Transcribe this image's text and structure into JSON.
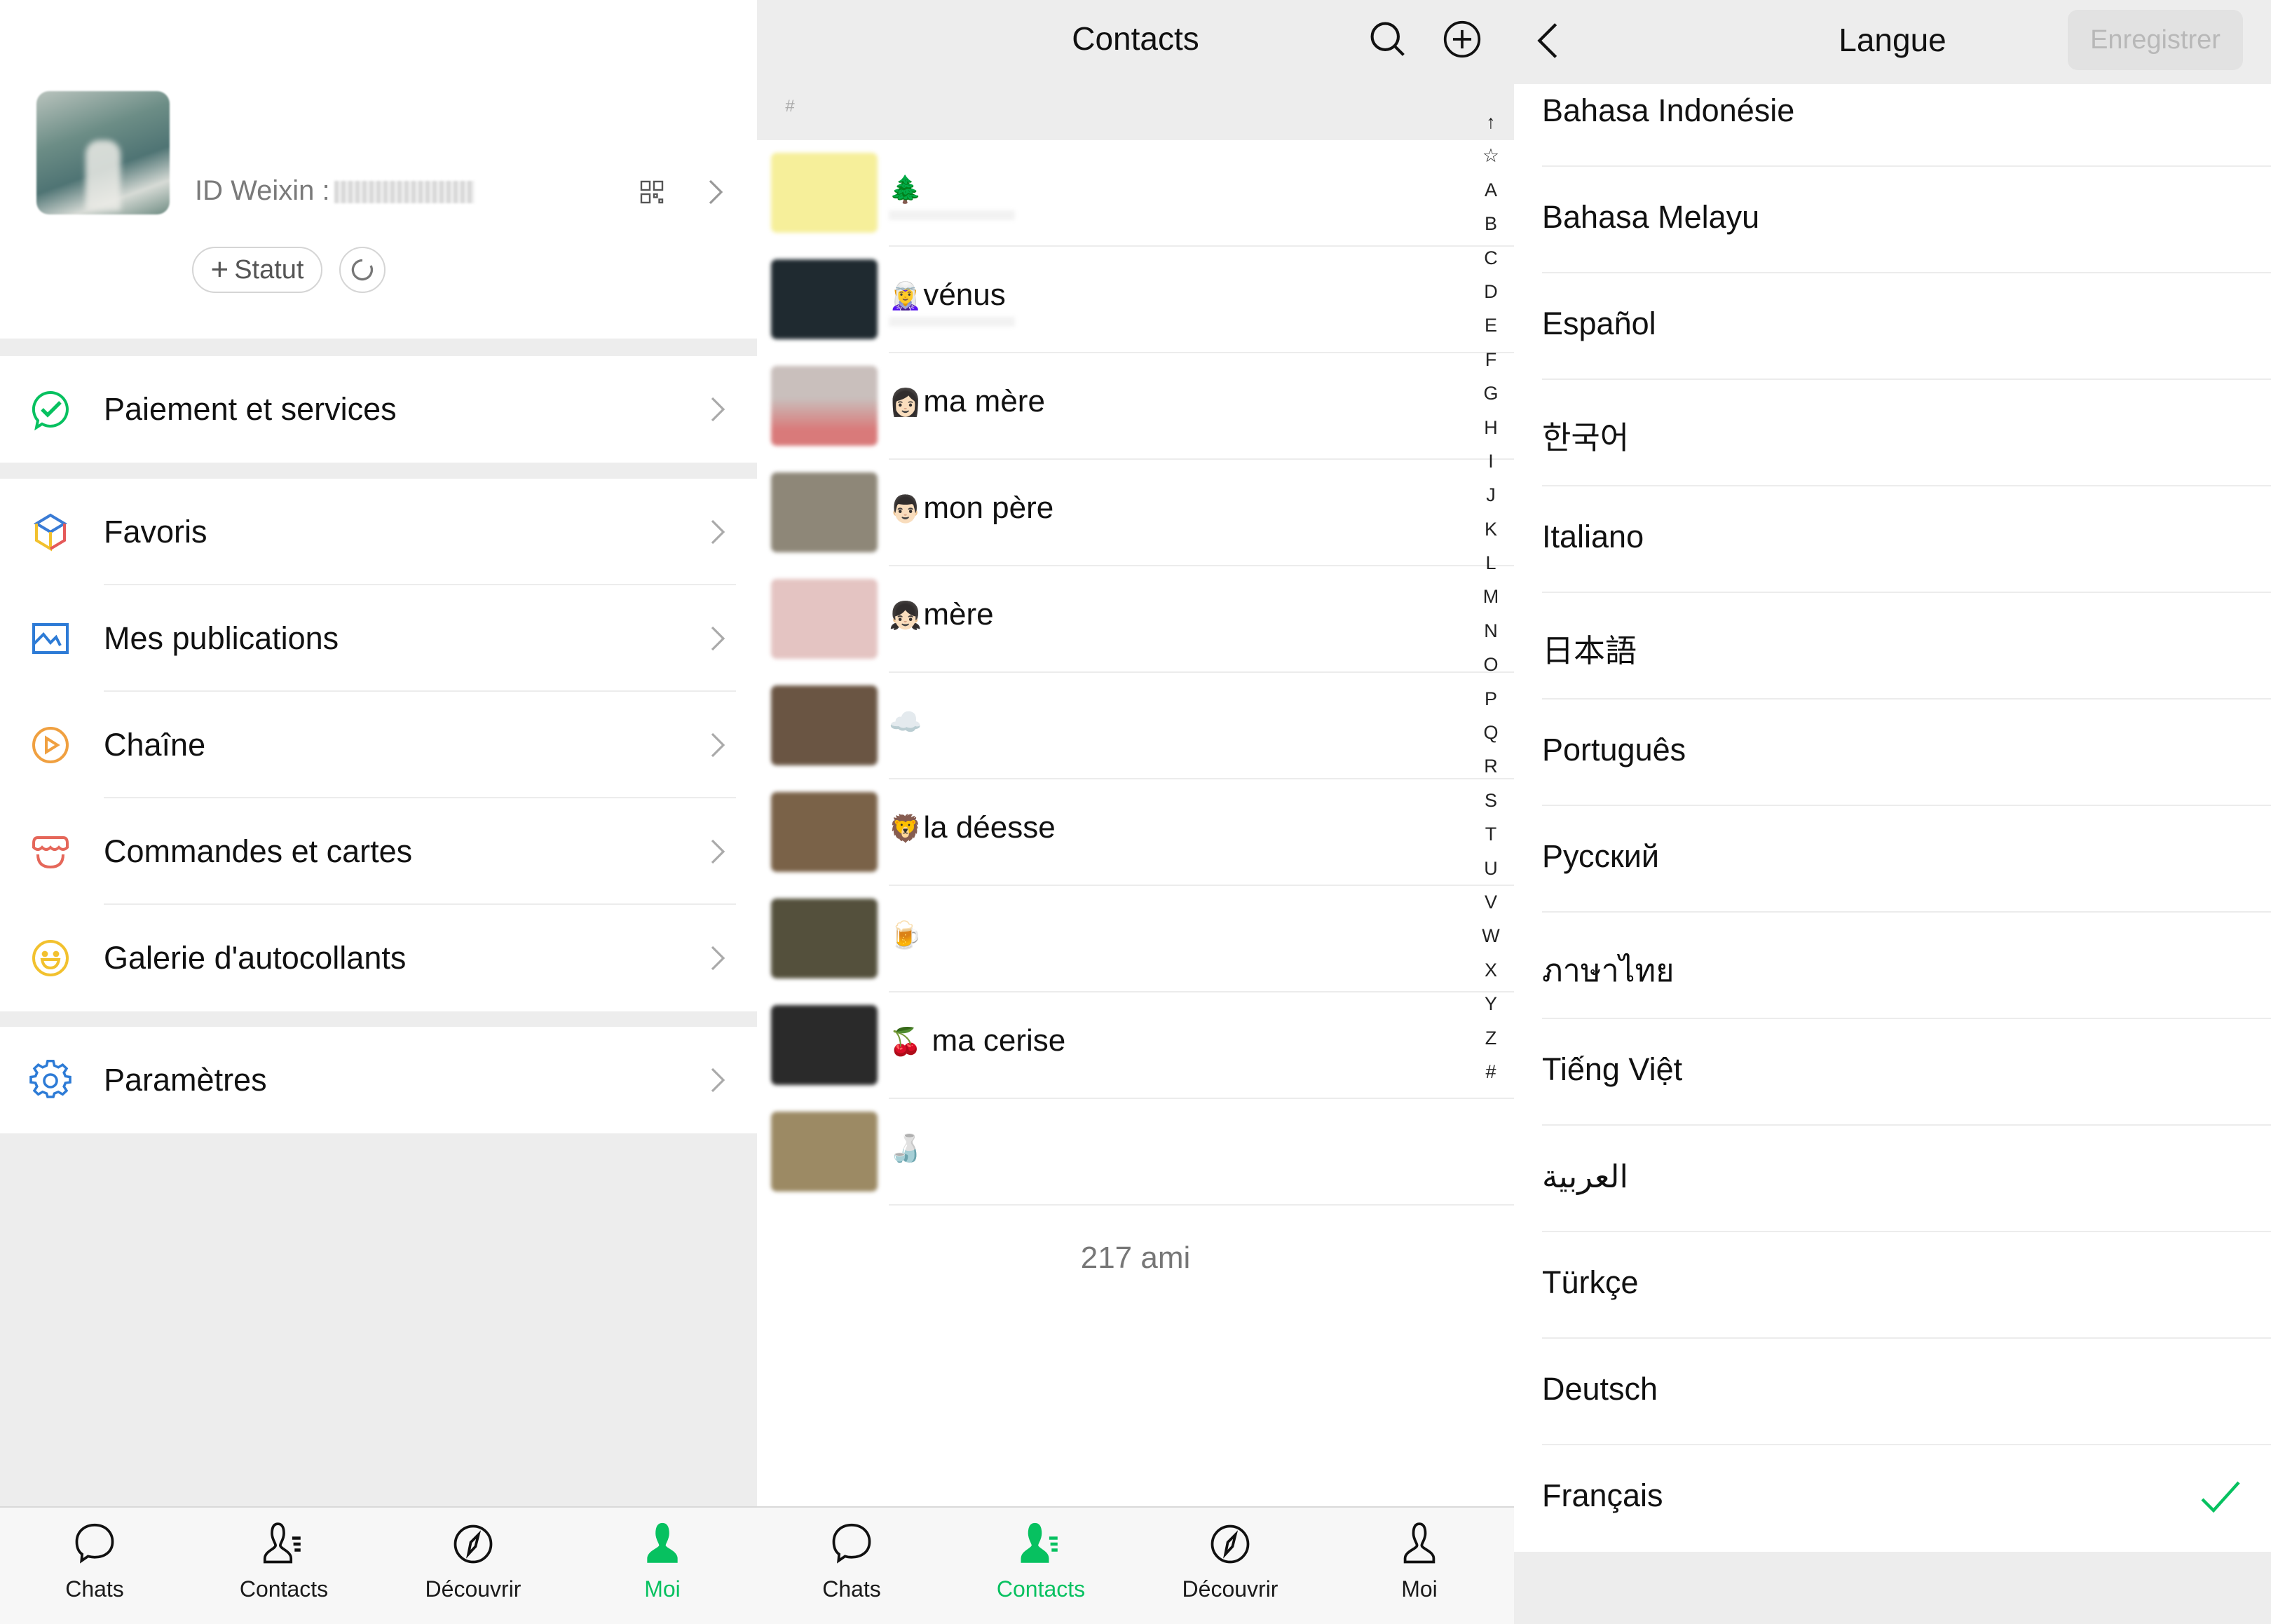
{
  "me": {
    "wechat_id_label": "ID Weixin :",
    "status_button": "Statut",
    "status_button_icon": "plus-icon",
    "menu_groups": [
      [
        {
          "label": "Paiement et services",
          "icon": "pay-check-icon"
        }
      ],
      [
        {
          "label": "Favoris",
          "icon": "cube-icon"
        },
        {
          "label": "Mes publications",
          "icon": "image-icon"
        },
        {
          "label": "Chaîne",
          "icon": "play-circle-icon"
        },
        {
          "label": "Commandes et cartes",
          "icon": "store-icon"
        },
        {
          "label": "Galerie d'autocollants",
          "icon": "smiley-icon"
        }
      ],
      [
        {
          "label": "Paramètres",
          "icon": "gear-icon"
        }
      ]
    ],
    "tabbar": [
      {
        "label": "Chats",
        "icon": "chat-bubble-icon",
        "active": false
      },
      {
        "label": "Contacts",
        "icon": "contacts-icon",
        "active": false
      },
      {
        "label": "Découvrir",
        "icon": "compass-icon",
        "active": false
      },
      {
        "label": "Moi",
        "icon": "person-icon",
        "active": true
      }
    ]
  },
  "contacts": {
    "title": "Contacts",
    "section_header": "#",
    "contacts": [
      {
        "emoji": "🌲",
        "name": ""
      },
      {
        "emoji": "🧝‍♀️",
        "name": "vénus"
      },
      {
        "emoji": "👩🏻",
        "name": "ma mère"
      },
      {
        "emoji": "👨🏻",
        "name": "mon père"
      },
      {
        "emoji": "👧🏻",
        "name": "mère"
      },
      {
        "emoji": "☁️",
        "name": ""
      },
      {
        "emoji": "🦁",
        "name": "la déesse"
      },
      {
        "emoji": "🍺",
        "name": ""
      },
      {
        "emoji": "🍒",
        "name": " ma cerise"
      },
      {
        "emoji": "🍶",
        "name": ""
      }
    ],
    "index_letters": [
      "↑",
      "☆",
      "A",
      "B",
      "C",
      "D",
      "E",
      "F",
      "G",
      "H",
      "I",
      "J",
      "K",
      "L",
      "M",
      "N",
      "O",
      "P",
      "Q",
      "R",
      "S",
      "T",
      "U",
      "V",
      "W",
      "X",
      "Y",
      "Z",
      "#"
    ],
    "friend_count": "217 ami",
    "tabbar": [
      {
        "label": "Chats",
        "icon": "chat-bubble-icon",
        "active": false
      },
      {
        "label": "Contacts",
        "icon": "contacts-icon",
        "active": true
      },
      {
        "label": "Découvrir",
        "icon": "compass-icon",
        "active": false
      },
      {
        "label": "Moi",
        "icon": "person-icon",
        "active": false
      }
    ]
  },
  "language": {
    "title": "Langue",
    "save_button": "Enregistrer",
    "selected": "Français",
    "options": [
      "Bahasa Indonésie",
      "Bahasa Melayu",
      "Español",
      "한국어",
      "Italiano",
      "日本語",
      "Português",
      "Русский",
      "ภาษาไทย",
      "Tiếng Việt",
      "العربية",
      "Türkçe",
      "Deutsch",
      "Français"
    ]
  },
  "colors": {
    "accent_green": "#07c160",
    "background_gray": "#ededed",
    "disabled_button": "#e2e2e2"
  }
}
